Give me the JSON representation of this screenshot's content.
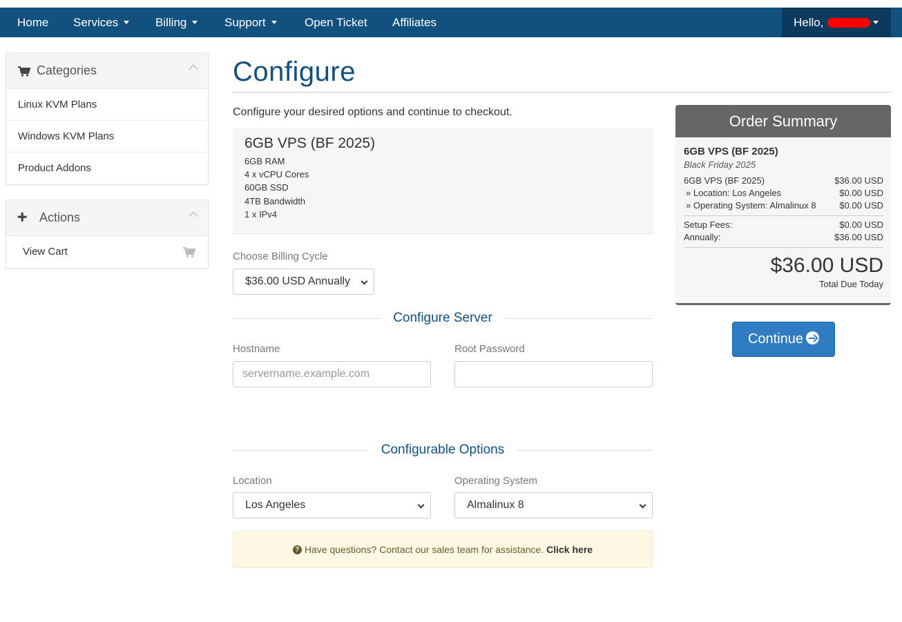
{
  "nav": {
    "items": [
      "Home",
      "Services",
      "Billing",
      "Support",
      "Open Ticket",
      "Affiliates"
    ],
    "user_greeting": "Hello,"
  },
  "sidebar": {
    "categories": {
      "title": "Categories",
      "items": [
        "Linux KVM Plans",
        "Windows KVM Plans",
        "Product Addons"
      ]
    },
    "actions": {
      "title": "Actions",
      "items": [
        "View Cart"
      ]
    }
  },
  "main": {
    "title": "Configure",
    "intro": "Configure your desired options and continue to checkout.",
    "product": {
      "name": "6GB VPS (BF 2025)",
      "features": [
        "6GB RAM",
        "4 x vCPU Cores",
        "60GB SSD",
        "4TB Bandwidth",
        "1 x IPv4"
      ]
    },
    "billing": {
      "label": "Choose Billing Cycle",
      "selected": "$36.00 USD Annually"
    },
    "configure_server": {
      "title": "Configure Server",
      "hostname_label": "Hostname",
      "hostname_placeholder": "servername.example.com",
      "hostname_value": "",
      "password_label": "Root Password",
      "password_value": ""
    },
    "configurable_options": {
      "title": "Configurable Options",
      "location_label": "Location",
      "location_selected": "Los Angeles",
      "os_label": "Operating System",
      "os_selected": "Almalinux 8"
    },
    "help": {
      "text": "Have questions? Contact our sales team for assistance.",
      "link": "Click here"
    }
  },
  "summary": {
    "title": "Order Summary",
    "product": "6GB VPS (BF 2025)",
    "group": "Black Friday 2025",
    "lines": [
      {
        "label": "6GB VPS (BF 2025)",
        "amount": "$36.00 USD"
      },
      {
        "label": "» Location: Los Angeles",
        "amount": "$0.00 USD"
      },
      {
        "label": "» Operating System: Almalinux 8",
        "amount": "$0.00 USD"
      }
    ],
    "setup_fees_label": "Setup Fees:",
    "setup_fees": "$0.00 USD",
    "recurring_label": "Annually:",
    "recurring": "$36.00 USD",
    "total": "$36.00 USD",
    "total_label": "Total Due Today"
  },
  "continue_label": "Continue",
  "colors": {
    "navbar": "#12507d",
    "user_menu": "#0c3a5c",
    "accent": "#12507d",
    "button": "#2f7dc0",
    "summary_header": "#666666",
    "alert_bg": "#fcf8e3"
  }
}
